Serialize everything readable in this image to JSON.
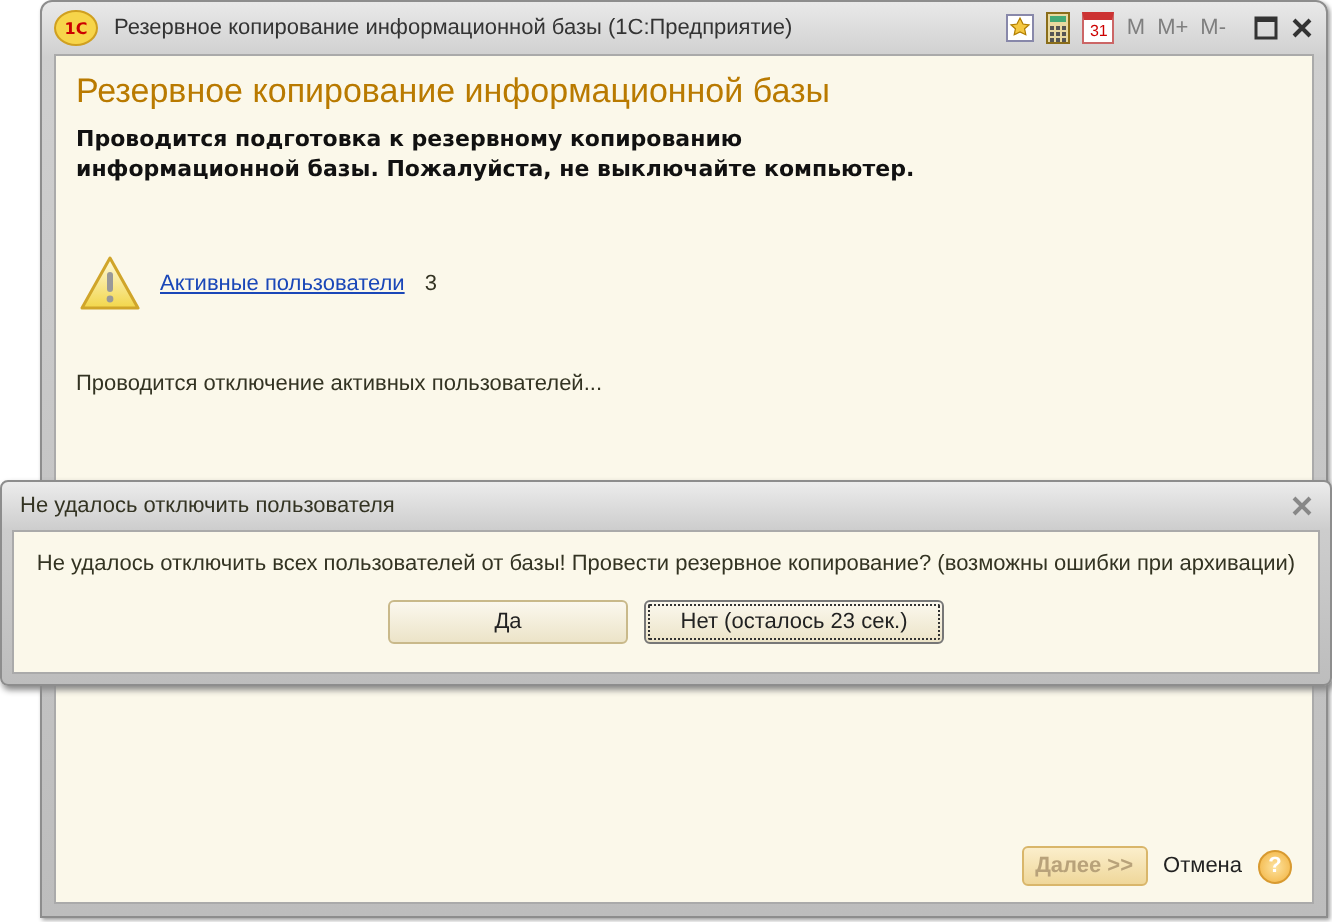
{
  "window": {
    "title": "Резервное копирование информационной базы  (1С:Предприятие)",
    "logo": "1С"
  },
  "toolbar": [
    {
      "kind": "favorite"
    },
    {
      "kind": "calculator"
    },
    {
      "kind": "calendar",
      "label": "31"
    },
    {
      "kind": "text",
      "label": "M",
      "disabled": true
    },
    {
      "kind": "text",
      "label": "M+",
      "disabled": true
    },
    {
      "kind": "text",
      "label": "M-",
      "disabled": true
    }
  ],
  "heading": "Резервное копирование информационной базы",
  "intro": "Проводится подготовка к резервному копированию\nинформационной базы. Пожалуйста, не выключайте компьютер.",
  "active_users": {
    "link": "Активные пользователи",
    "count": "3"
  },
  "status": "Проводится отключение активных пользователей...",
  "footer": {
    "next": {
      "label": "Далее >>",
      "disabled": true
    },
    "cancel": "Отмена",
    "help": "?"
  },
  "dialog": {
    "title": "Не удалось отключить пользователя",
    "message": "Не удалось отключить всех пользователей от базы! Провести резервное копирование? (возможны ошибки при архивации)",
    "buttons": [
      {
        "label": "Да",
        "selected": false
      },
      {
        "label": "Нет (осталось 23 сек.)",
        "selected": true
      }
    ]
  }
}
